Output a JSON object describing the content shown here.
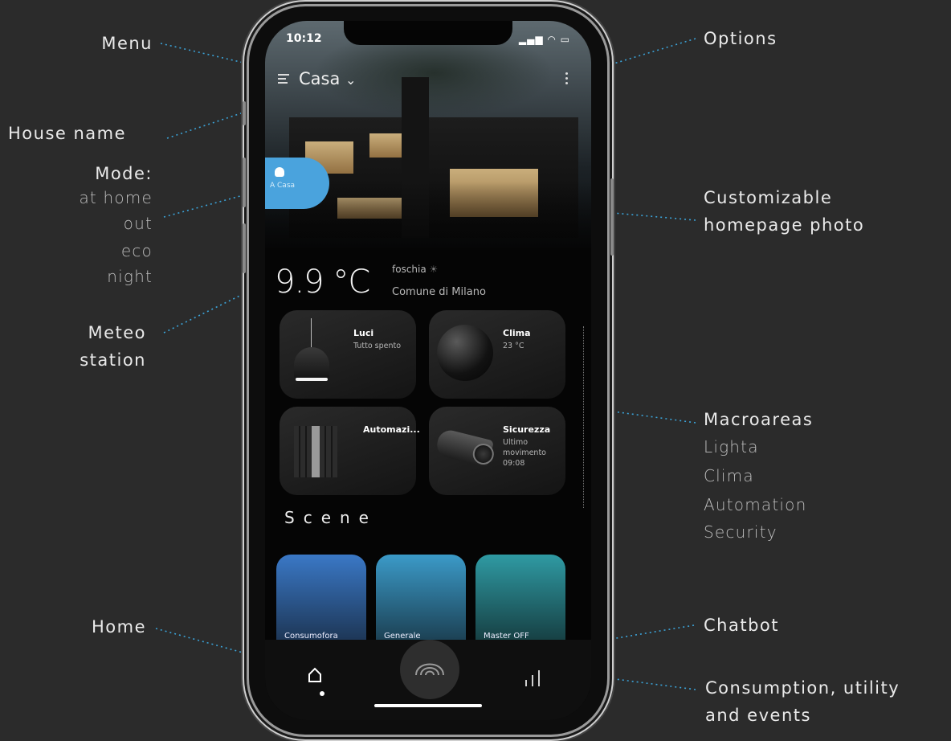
{
  "annotations": {
    "menu": "Menu",
    "house_name": "House name",
    "mode_title": "Mode:",
    "modes": [
      "at home",
      "out",
      "eco",
      "night"
    ],
    "meteo": [
      "Meteo",
      "station"
    ],
    "home": "Home",
    "options": "Options",
    "photo": [
      "Customizable",
      "homepage photo"
    ],
    "macro_title": "Macroareas",
    "macro_items": [
      "Lighta",
      "Clima",
      "Automation",
      "Security"
    ],
    "chatbot": "Chatbot",
    "consumption": [
      "Consumption, utility",
      "and events"
    ]
  },
  "phone": {
    "time": "10:12",
    "house_name": "Casa",
    "mode_label": "A Casa",
    "temperature": "9.9 °C",
    "weather": "foschia",
    "location": "Comune di Milano",
    "macroareas": [
      {
        "title": "Luci",
        "subtitle": "Tutto spento"
      },
      {
        "title": "Clima",
        "subtitle": "23 °C"
      },
      {
        "title": "Automazi...",
        "subtitle": ""
      },
      {
        "title": "Sicurezza",
        "subtitle": "Ultimo\nmovimento\n09:08"
      }
    ],
    "scene_title": "Scene",
    "scenes": [
      "Consumofora",
      "Generale",
      "Master OFF"
    ]
  },
  "colors": {
    "background": "#2b2b2b",
    "mode_pill": "#4aa3dd",
    "leader_line": "#3ba3d8",
    "scene_1": "#3a78c6",
    "scene_2": "#3b9ac8",
    "scene_3": "#2f9aa3"
  },
  "icons": [
    "menu-icon",
    "chevron-down-icon",
    "options-icon",
    "home-icon",
    "chatbot-icon",
    "bar-chart-icon"
  ]
}
